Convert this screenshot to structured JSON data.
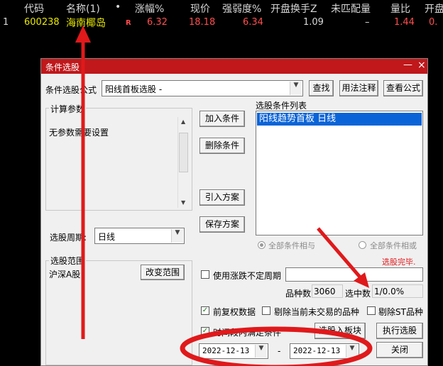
{
  "header": {
    "code": "代码",
    "name": "名称(1)",
    "dot": "•",
    "change_pct": "涨幅%",
    "price": "现价",
    "strength": "强弱度%",
    "open_turnover": "开盘换手Z",
    "unmatched": "未匹配量",
    "volume_ratio": "量比",
    "open_cut": "开盘"
  },
  "row": {
    "index": "1",
    "code": "600238",
    "name": "海南椰岛",
    "flag": "R",
    "change_pct": "6.32",
    "price": "18.18",
    "strength": "6.34",
    "open_turnover": "1.09",
    "unmatched": "–",
    "volume_ratio": "1.44",
    "open_cut": "0."
  },
  "dialog": {
    "title": "条件选股",
    "min_icon": "—",
    "close_icon": "×",
    "formula_label": "条件选股公式",
    "formula_value": "阳线首板选股 -",
    "find_button": "查找",
    "usage_button": "用法注释",
    "view_button": "查看公式",
    "params_group": "计算参数",
    "params_text": "无参数需要设置",
    "add_condition": "加入条件",
    "delete_condition": "删除条件",
    "import_plan": "引入方案",
    "save_plan": "保存方案",
    "condition_list_label": "选股条件列表",
    "condition_items": [
      "阳线趋势首板  日线"
    ],
    "period_label": "选股周期:",
    "period_value": "日线",
    "radio_all_and": "全部条件相与",
    "radio_all_or": "全部条件相或",
    "status": "选股完毕.",
    "range_group": "选股范围",
    "range_value": "沪深A股",
    "change_range_button": "改变范围",
    "use_uncertain_period": "使用涨跌不定周期",
    "stock_count_label": "品种数",
    "stock_count": "3060",
    "selected_label": "选中数",
    "selected_value": "1/0.0%",
    "pre_adjusted": "前复权数据",
    "exclude_untraded": "剔除当前未交易的品种",
    "exclude_st": "剔除ST品种",
    "time_range_cond": "时间段内满足条件",
    "select_to_block": "选股入板块",
    "run_button": "执行选股",
    "date_from": "2022-12-13",
    "date_sep": "-",
    "date_to": "2022-12-13",
    "close_button": "关闭"
  },
  "colors": {
    "title_bar": "#c0181b",
    "up_red": "#ff4d4d",
    "code_yellow": "#e8e800",
    "selection_blue": "#0a64d8",
    "annotation_red": "#e0191b"
  }
}
